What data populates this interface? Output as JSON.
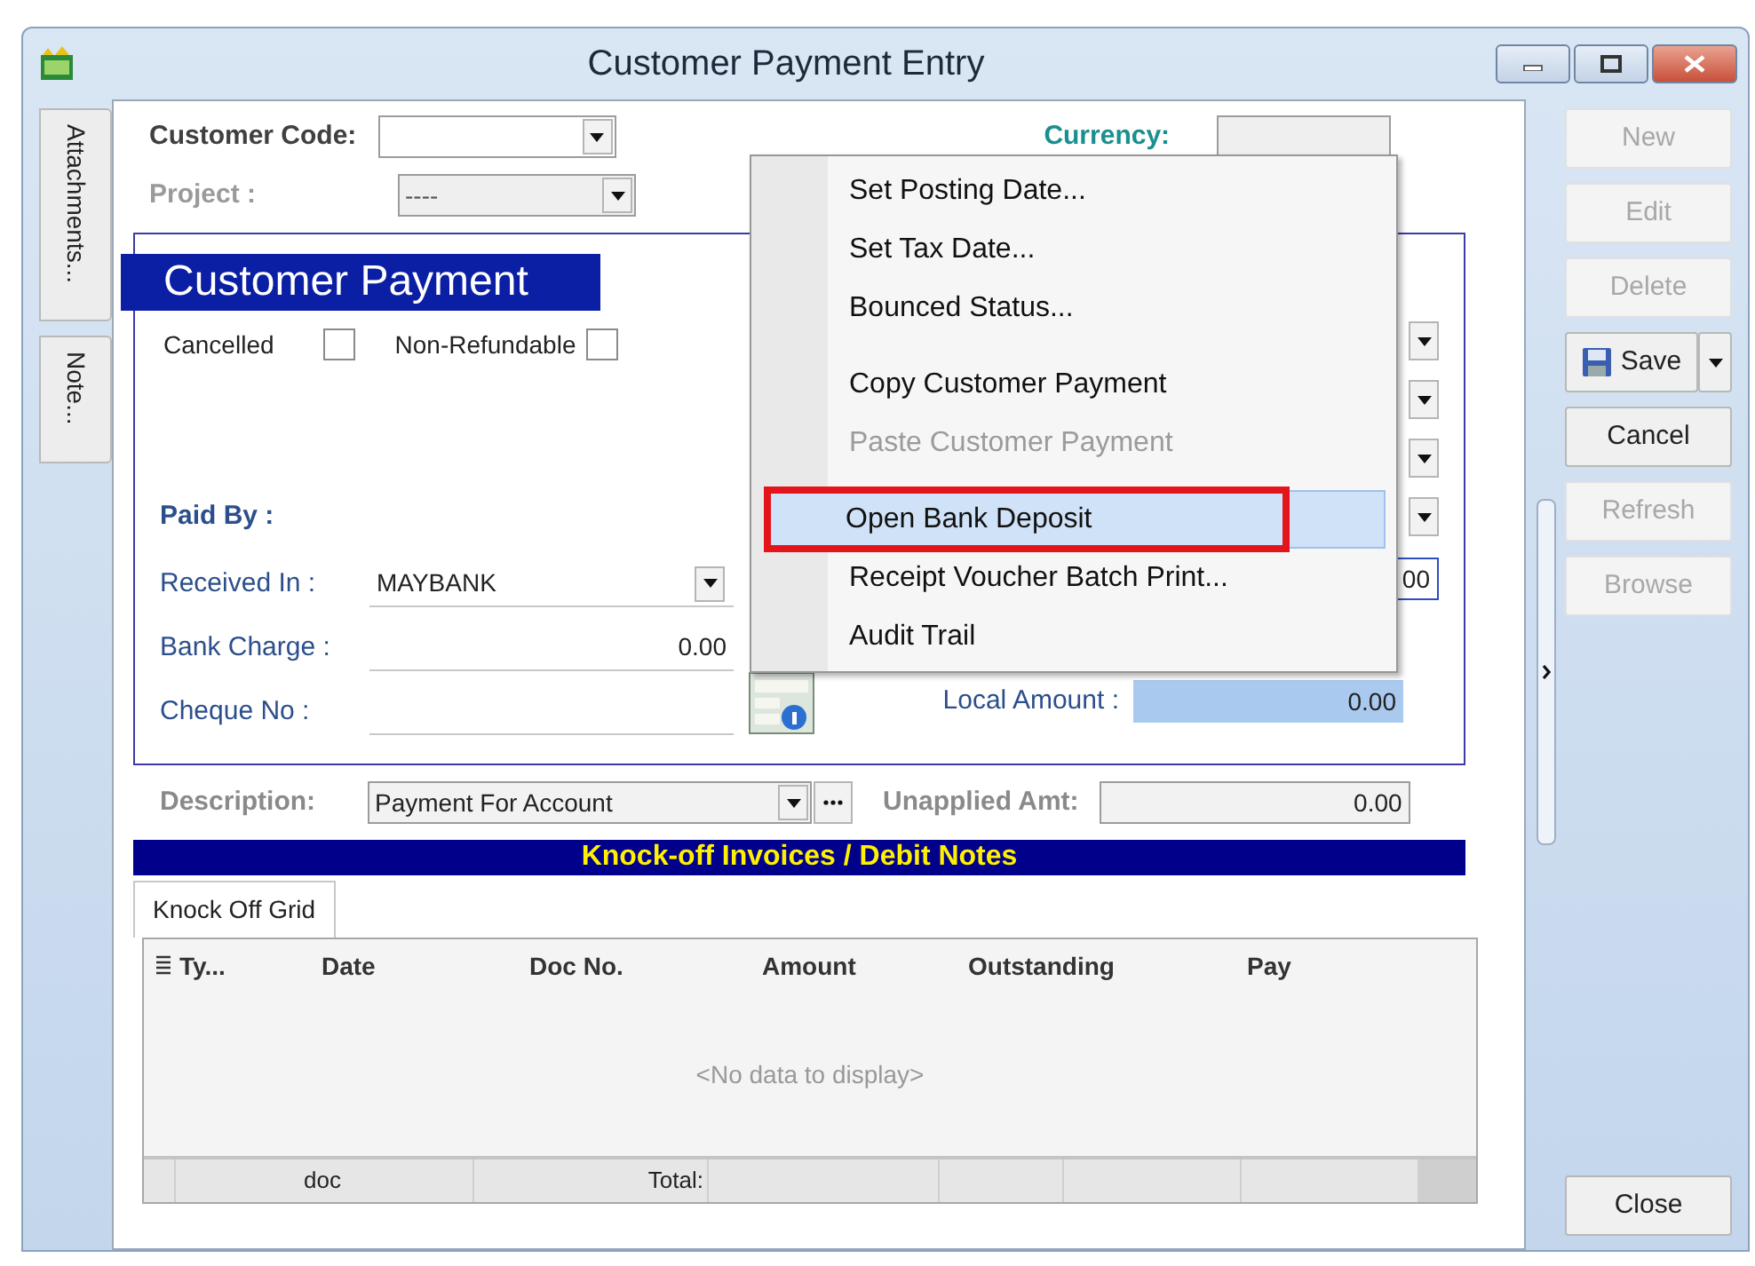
{
  "window": {
    "title": "Customer Payment Entry"
  },
  "side_tabs": [
    {
      "label": "Attachments..."
    },
    {
      "label": "Note..."
    }
  ],
  "header": {
    "customer_code_label": "Customer Code:",
    "project": {
      "label": "Project :",
      "value": "----",
      "disabled": true
    },
    "currency_label": "Currency:"
  },
  "payment": {
    "title": "Customer Payment",
    "checkboxes": [
      {
        "label": "Cancelled",
        "checked": false
      },
      {
        "label": "Non-Refundable",
        "checked": false
      }
    ],
    "paid_by_label": "Paid By :",
    "fields": [
      {
        "label": "Received In :",
        "value": "MAYBANK",
        "kind": "combo"
      },
      {
        "label": "Bank Charge :",
        "value": "0.00",
        "kind": "amount"
      },
      {
        "label": "Cheque No :",
        "kind": "text"
      }
    ],
    "covered_value": "00",
    "local_amount": {
      "label": "Local Amount :",
      "value": "0.00"
    }
  },
  "description": {
    "label": "Description:",
    "value": "Payment For Account"
  },
  "unapplied": {
    "label": "Unapplied Amt:",
    "value": "0.00"
  },
  "knockoff": {
    "title": "Knock-off Invoices / Debit Notes",
    "tabs": [
      {
        "label": "Knock Off Grid",
        "selected": true
      }
    ],
    "columns": [
      "Ty...",
      "Date",
      "Doc No.",
      "Amount",
      "Outstanding",
      "Pay"
    ],
    "empty_text": "<No data to display>",
    "footer": [
      "doc",
      "Total:"
    ]
  },
  "buttons": [
    {
      "label": "New",
      "disabled": true,
      "kind": "plain"
    },
    {
      "label": "Edit",
      "disabled": true,
      "kind": "plain"
    },
    {
      "label": "Delete",
      "disabled": true,
      "kind": "plain"
    },
    {
      "label": "Save",
      "disabled": false,
      "kind": "split"
    },
    {
      "label": "Cancel",
      "disabled": false,
      "kind": "plain"
    },
    {
      "label": "Refresh",
      "disabled": true,
      "kind": "plain"
    },
    {
      "label": "Browse",
      "disabled": true,
      "kind": "plain"
    }
  ],
  "close_button": "Close",
  "context_menu": {
    "items": [
      {
        "kind": "item",
        "label": "Set Posting Date...",
        "disabled": false,
        "selected": false,
        "annotated": false
      },
      {
        "kind": "item",
        "label": "Set Tax Date...",
        "disabled": false,
        "selected": false,
        "annotated": false
      },
      {
        "kind": "item",
        "label": "Bounced Status...",
        "disabled": false,
        "selected": false,
        "annotated": false
      },
      {
        "kind": "separator"
      },
      {
        "kind": "item",
        "label": "Copy Customer Payment",
        "disabled": false,
        "selected": false,
        "annotated": false
      },
      {
        "kind": "item",
        "label": "Paste Customer Payment",
        "disabled": true,
        "selected": false,
        "annotated": false
      },
      {
        "kind": "separator"
      },
      {
        "kind": "item",
        "label": "Open Bank Deposit",
        "disabled": false,
        "selected": true,
        "annotated": true
      },
      {
        "kind": "item",
        "label": "Receipt Voucher Batch Print...",
        "disabled": false,
        "selected": false,
        "annotated": false
      },
      {
        "kind": "item",
        "label": "Audit Trail",
        "disabled": false,
        "selected": false,
        "annotated": false
      }
    ]
  }
}
